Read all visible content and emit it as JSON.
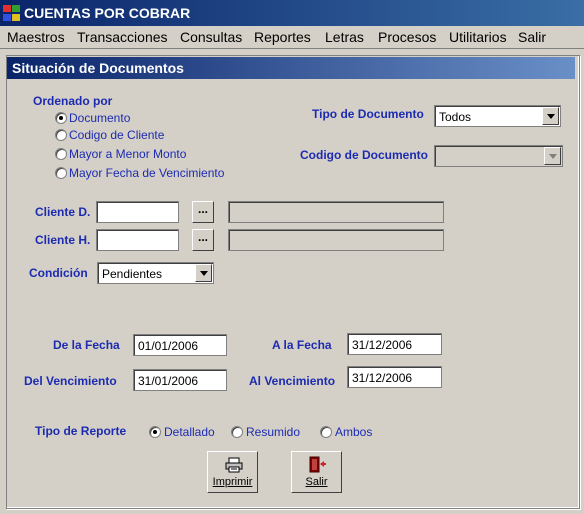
{
  "window": {
    "title": "CUENTAS POR COBRAR"
  },
  "menu": [
    "Maestros",
    "Transacciones",
    "Consultas",
    "Reportes",
    "Letras",
    "Procesos",
    "Utilitarios",
    "Salir"
  ],
  "panel": {
    "title": "Situación de Documentos"
  },
  "ordenado": {
    "label": "Ordenado por",
    "options": [
      "Documento",
      "Codigo de Cliente",
      "Mayor a Menor Monto",
      "Mayor Fecha de Vencimiento"
    ],
    "selected": 0
  },
  "tipo_documento": {
    "label": "Tipo de Documento",
    "value": "Todos"
  },
  "codigo_documento": {
    "label": "Codigo de Documento",
    "value": ""
  },
  "cliente_d": {
    "label": "Cliente D.",
    "code": "",
    "name": "",
    "lookup": "..."
  },
  "cliente_h": {
    "label": "Cliente H.",
    "code": "",
    "name": "",
    "lookup": "..."
  },
  "condicion": {
    "label": "Condición",
    "value": "Pendientes"
  },
  "de_fecha": {
    "label": "De la Fecha",
    "value": "01/01/2006"
  },
  "a_fecha": {
    "label": "A la Fecha",
    "value": "31/12/2006"
  },
  "del_vencimiento": {
    "label": "Del Vencimiento",
    "value": "31/01/2006"
  },
  "al_vencimiento": {
    "label": "Al Vencimiento",
    "value": "31/12/2006"
  },
  "tipo_reporte": {
    "label": "Tipo de Reporte",
    "options": [
      "Detallado",
      "Resumido",
      "Ambos"
    ],
    "selected": 0
  },
  "buttons": {
    "imprimir": "Imprimir",
    "salir": "Salir"
  },
  "icons": {
    "app": "app-icon",
    "print": "printer-icon",
    "exit": "exit-door-icon"
  }
}
